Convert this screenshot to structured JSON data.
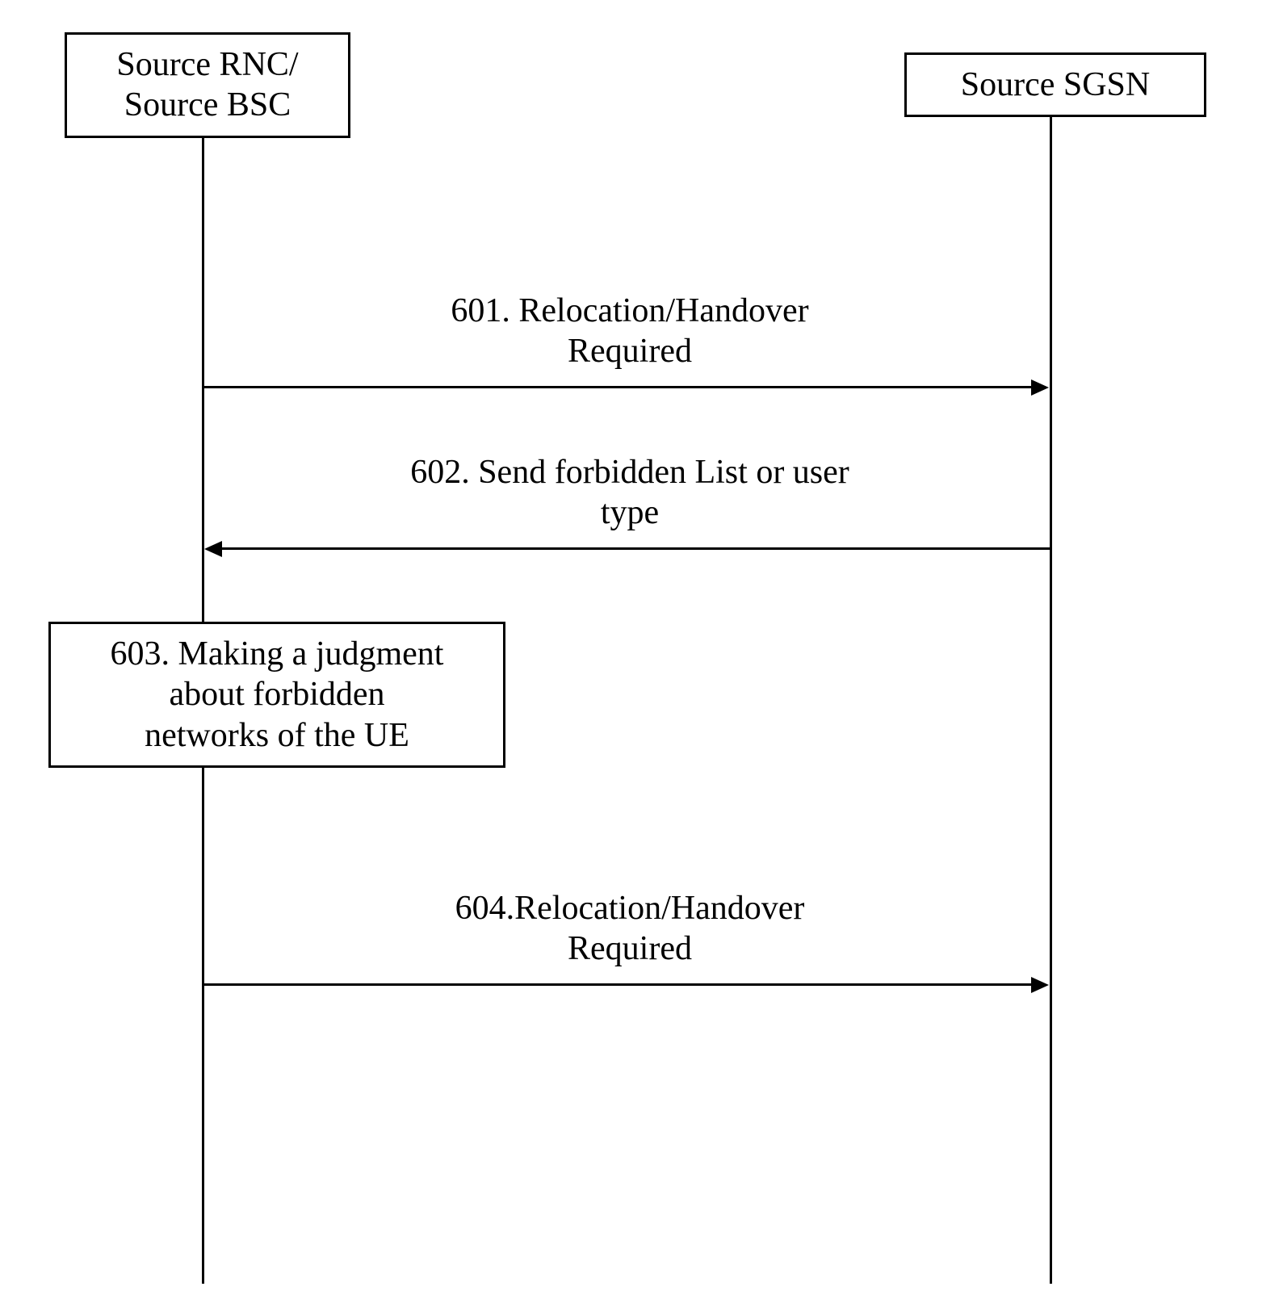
{
  "participants": {
    "source_rnc_bsc": {
      "line1": "Source RNC/",
      "line2": "Source BSC"
    },
    "source_sgsn": "Source SGSN"
  },
  "messages": {
    "m601": {
      "line1": "601. Relocation/Handover",
      "line2": "Required"
    },
    "m602": {
      "line1": "602. Send forbidden List or user",
      "line2": "type"
    },
    "m604": {
      "line1": "604.Relocation/Handover",
      "line2": "Required"
    }
  },
  "actions": {
    "a603": {
      "line1": "603. Making a judgment",
      "line2": "about forbidden",
      "line3": "networks of the UE"
    }
  }
}
